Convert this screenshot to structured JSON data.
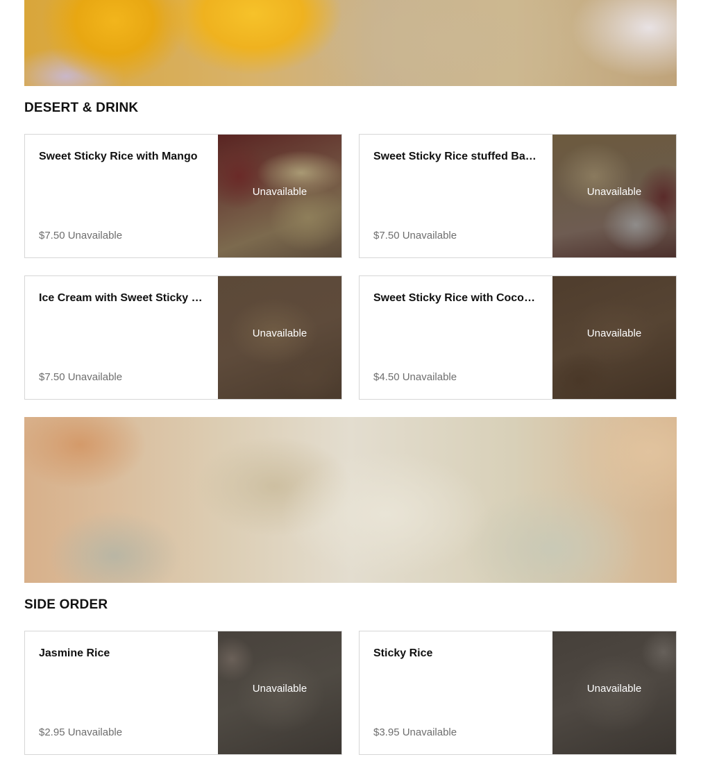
{
  "sections": [
    {
      "title": "DESERT & DRINK",
      "items": [
        {
          "name": "Sweet Sticky Rice with Mango",
          "price": "$7.50",
          "status": "Unavailable",
          "image_status": "Unavailable"
        },
        {
          "name": "Sweet Sticky Rice stuffed Banana",
          "price": "$7.50",
          "status": "Unavailable",
          "image_status": "Unavailable"
        },
        {
          "name": "Ice Cream with Sweet Sticky Rice",
          "price": "$7.50",
          "status": "Unavailable",
          "image_status": "Unavailable"
        },
        {
          "name": "Sweet Sticky Rice with Coconut",
          "price": "$4.50",
          "status": "Unavailable",
          "image_status": "Unavailable"
        }
      ]
    },
    {
      "title": "SIDE ORDER",
      "items": [
        {
          "name": "Jasmine Rice",
          "price": "$2.95",
          "status": "Unavailable",
          "image_status": "Unavailable"
        },
        {
          "name": "Sticky Rice",
          "price": "$3.95",
          "status": "Unavailable",
          "image_status": "Unavailable"
        }
      ]
    }
  ]
}
